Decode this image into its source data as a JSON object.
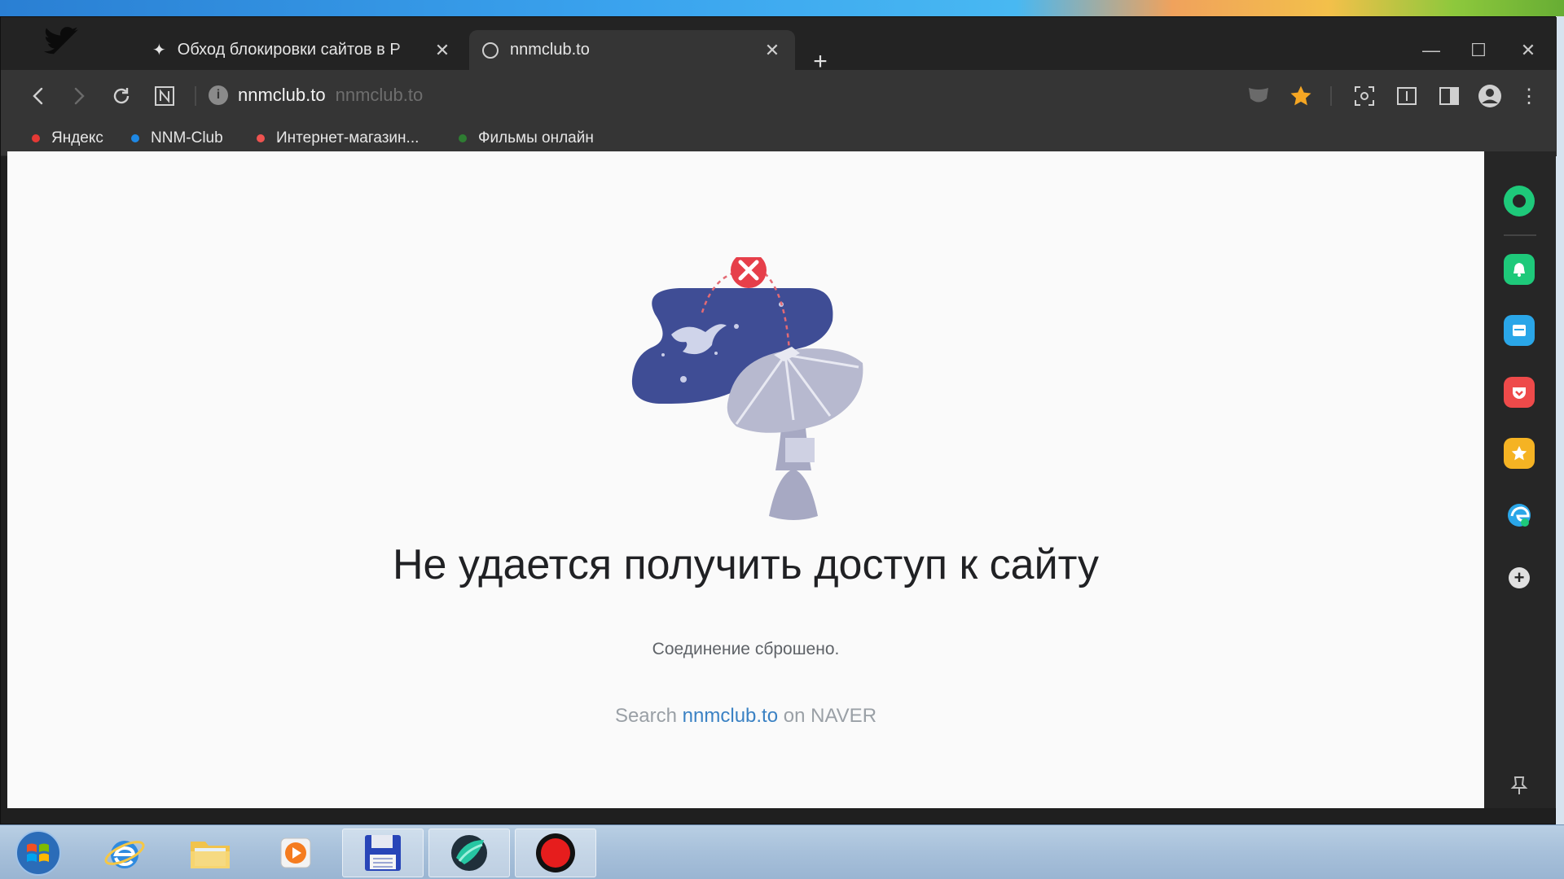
{
  "tabs": [
    {
      "title": "Обход блокировки сайтов в Р",
      "icon": "sparkle-icon",
      "active": false
    },
    {
      "title": "nnmclub.to",
      "icon": "globe-icon",
      "active": true
    }
  ],
  "address_bar": {
    "host": "nnmclub.to",
    "path": "nnmclub.to"
  },
  "bookmarks": [
    {
      "label": "Яндекс",
      "color": "#e53935"
    },
    {
      "label": "NNM-Club",
      "color": "#1e88e5"
    },
    {
      "label": "Интернет-магазин...",
      "color": "#ef5350"
    },
    {
      "label": "Фильмы онлайн",
      "color": "#2e7d32"
    }
  ],
  "error_page": {
    "title": "Не удается получить доступ к сайту",
    "subtitle": "Соединение сброшено.",
    "search_prefix": "Search",
    "search_link": "nnmclub.to",
    "search_suffix": "on NAVER"
  },
  "side_panel": {
    "items": [
      "green-circle-icon",
      "bell-icon",
      "calendar-icon",
      "pocket-icon",
      "star-icon",
      "edge-icon",
      "plus-icon"
    ],
    "colors": {
      "green": "#1ec97a",
      "blue": "#2aa6e8",
      "red": "#ee4a4a",
      "yellow": "#f5b323"
    }
  },
  "theme": {
    "toolbar": "#353535",
    "tabstrip": "#232323",
    "accent_star": "#f5a623"
  }
}
